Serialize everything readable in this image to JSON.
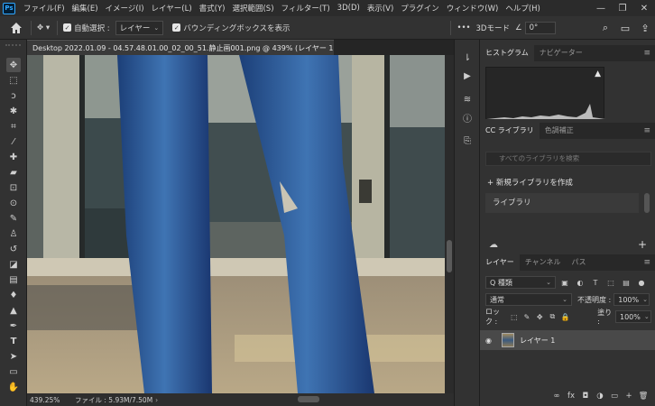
{
  "menubar": {
    "logo": "Ps",
    "items": [
      "ファイル(F)",
      "編集(E)",
      "イメージ(I)",
      "レイヤー(L)",
      "書式(Y)",
      "選択範囲(S)",
      "フィルター(T)",
      "3D(D)",
      "表示(V)",
      "プラグイン",
      "ウィンドウ(W)",
      "ヘルプ(H)"
    ],
    "window_controls": [
      "—",
      "❐",
      "✕"
    ]
  },
  "options": {
    "auto_select_label": "自動選択 :",
    "layer_select_value": "レイヤー",
    "bbox_label": "バウンディングボックスを表示",
    "more_glyph": "•••",
    "mode_3d": "3Dモード",
    "angle_value": "0°"
  },
  "document_tab": {
    "title": "Desktop 2022.01.09 - 04.57.48.01.00_02_00_51.静止画001.png @ 439% (レイヤー 1, RGB/8) *",
    "close": "×"
  },
  "status": {
    "zoom": "439.25%",
    "info": "ファイル : 5.93M/7.50M",
    "arrow": "›"
  },
  "panels": {
    "histogram_tabs": [
      "ヒストグラム",
      "ナビゲーター"
    ],
    "histogram_warning": "▲",
    "library_tabs": [
      "CC ライブラリ",
      "色調補正"
    ],
    "library_search_placeholder": "すべてのライブラリを検索",
    "new_library": "+ 新規ライブラリを作成",
    "library_dropdown": "ライブラリ",
    "library_add": "+",
    "layers_tabs": [
      "レイヤー",
      "チャンネル",
      "パス"
    ],
    "kind_label": "Q 種類",
    "blend_mode": "通常",
    "opacity_label": "不透明度 :",
    "opacity_value": "100%",
    "lock_label": "ロック :",
    "fill_label": "塗り :",
    "fill_value": "100%",
    "layer_name": "レイヤー 1",
    "footer_icons": [
      "∞",
      "fx",
      "◘",
      "◑",
      "▭",
      "+",
      "🗑"
    ]
  }
}
